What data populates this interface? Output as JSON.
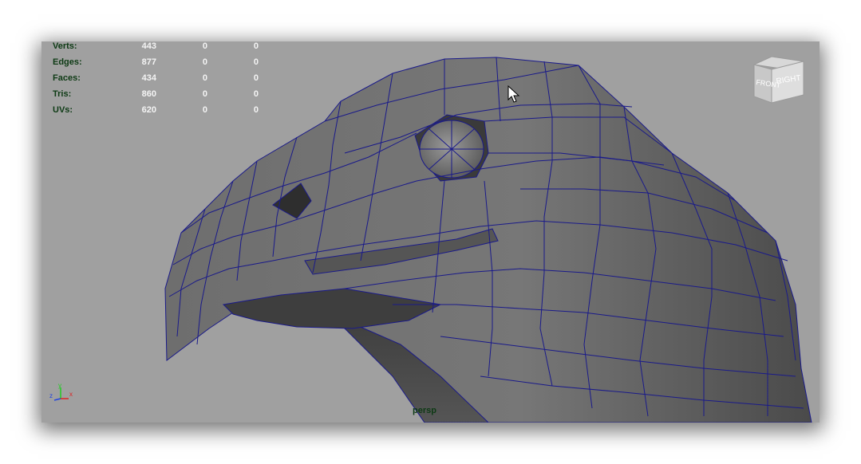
{
  "hud": {
    "rows": [
      {
        "label": "Verts:",
        "v1": "443",
        "v2": "0",
        "v3": "0"
      },
      {
        "label": "Edges:",
        "v1": "877",
        "v2": "0",
        "v3": "0"
      },
      {
        "label": "Faces:",
        "v1": "434",
        "v2": "0",
        "v3": "0"
      },
      {
        "label": "Tris:",
        "v1": "860",
        "v2": "0",
        "v3": "0"
      },
      {
        "label": "UVs:",
        "v1": "620",
        "v2": "0",
        "v3": "0"
      }
    ]
  },
  "camera": {
    "name": "persp"
  },
  "viewcube": {
    "front_label": "FRONT",
    "right_label": "RIGHT"
  },
  "axis": {
    "x_label": "x",
    "y_label": "y",
    "z_label": "z"
  },
  "colors": {
    "viewport_bg": "#a0a0a0",
    "wireframe": "#1a1a8a",
    "hud_label": "#0d3a14",
    "hud_value": "#f4f4f4"
  }
}
